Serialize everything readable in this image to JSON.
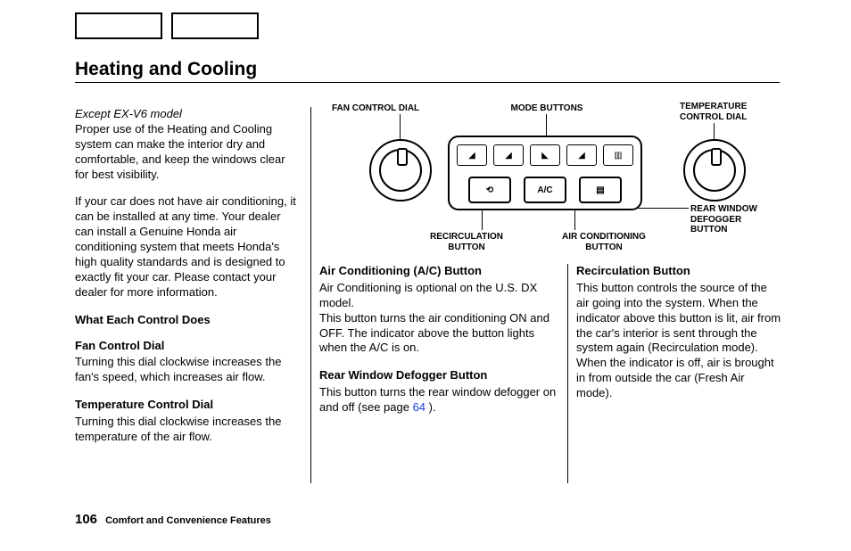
{
  "page": {
    "title": "Heating and Cooling",
    "number": "106",
    "footer": "Comfort and Convenience Features"
  },
  "col1": {
    "model_note": "Except EX-V6 model",
    "intro_p1": "Proper use of the Heating and Cooling system can make the interior dry and comfortable, and keep the windows clear for best visibility.",
    "intro_p2": "If your car does not have air conditioning, it can be installed at any time. Your dealer can install a Genuine Honda air conditioning system that meets Honda's high quality standards and is designed to exactly fit your car. Please contact your dealer for more information.",
    "what_each": "What Each Control Does",
    "fan_h": "Fan Control Dial",
    "fan_p": "Turning this dial clockwise increases the fan's speed, which increases air flow.",
    "temp_h": "Temperature Control Dial",
    "temp_p": "Turning this dial clockwise increases the temperature of the air flow."
  },
  "col2": {
    "ac_h": "Air Conditioning (A/C) Button",
    "ac_p1": "Air Conditioning is optional on the U.S. DX model.",
    "ac_p2": "This button turns the air condi­tioning ON and OFF. The indicator above the button lights when the A/C is on.",
    "defog_h": "Rear Window Defogger Button",
    "defog_p_a": "This button turns the rear window defogger on and off (see page ",
    "defog_page": "64",
    "defog_p_b": " )."
  },
  "col3": {
    "recirc_h": "Recirculation Button",
    "recirc_p": "This button controls the source of the air going into the system. When the indicator above this button is lit, air from the car's interior is sent through the system again (Recircula­tion mode). When the indicator is off, air is brought in from outside the car (Fresh Air mode)."
  },
  "diagram": {
    "fan": "FAN CONTROL DIAL",
    "mode": "MODE BUTTONS",
    "temp": "TEMPERATURE\nCONTROL DIAL",
    "recirc": "RECIRCULATION\nBUTTON",
    "ac": "AIR CONDITIONING\nBUTTON",
    "rear": "REAR WINDOW\nDEFOGGER\nBUTTON",
    "ac_label": "A/C"
  }
}
